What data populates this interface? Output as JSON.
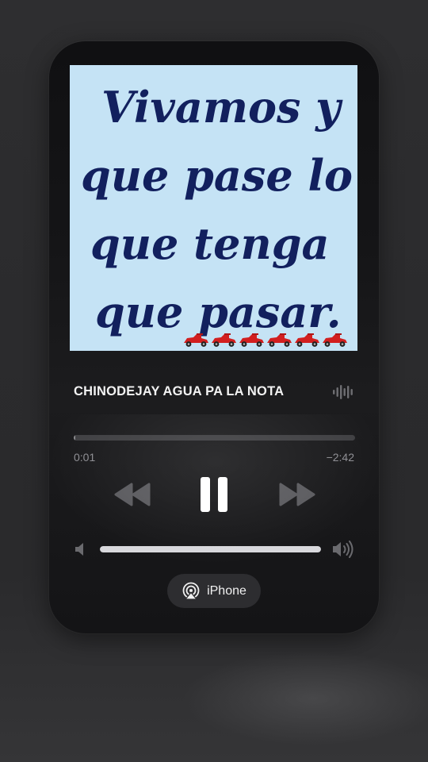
{
  "artwork": {
    "lines": [
      "Vivamos y",
      "que pase lo",
      "que tenga",
      "que pasar."
    ],
    "ink_color": "#12205e",
    "background_color": "#c5e3f5",
    "decoration_icon": "race-car-emoji",
    "decoration_count": 6
  },
  "track": {
    "title": "CHINODEJAY AGUA PA LA NOTA",
    "indicator_icon": "audio-waveform-icon"
  },
  "playback": {
    "elapsed": "0:01",
    "remaining": "−2:42",
    "progress": 0.006
  },
  "controls": {
    "rewind_icon": "rewind-icon",
    "pause_icon": "pause-icon",
    "forward_icon": "fast-forward-icon"
  },
  "volume": {
    "level": 1.0,
    "low_icon": "speaker-low-icon",
    "high_icon": "speaker-high-icon"
  },
  "output": {
    "device_label": "iPhone",
    "icon": "airplay-icon"
  },
  "colors": {
    "card_bg": "#151517",
    "text_primary": "#f2f2f2",
    "text_secondary": "#8e8e93",
    "control_dim": "#5a5a5e"
  }
}
